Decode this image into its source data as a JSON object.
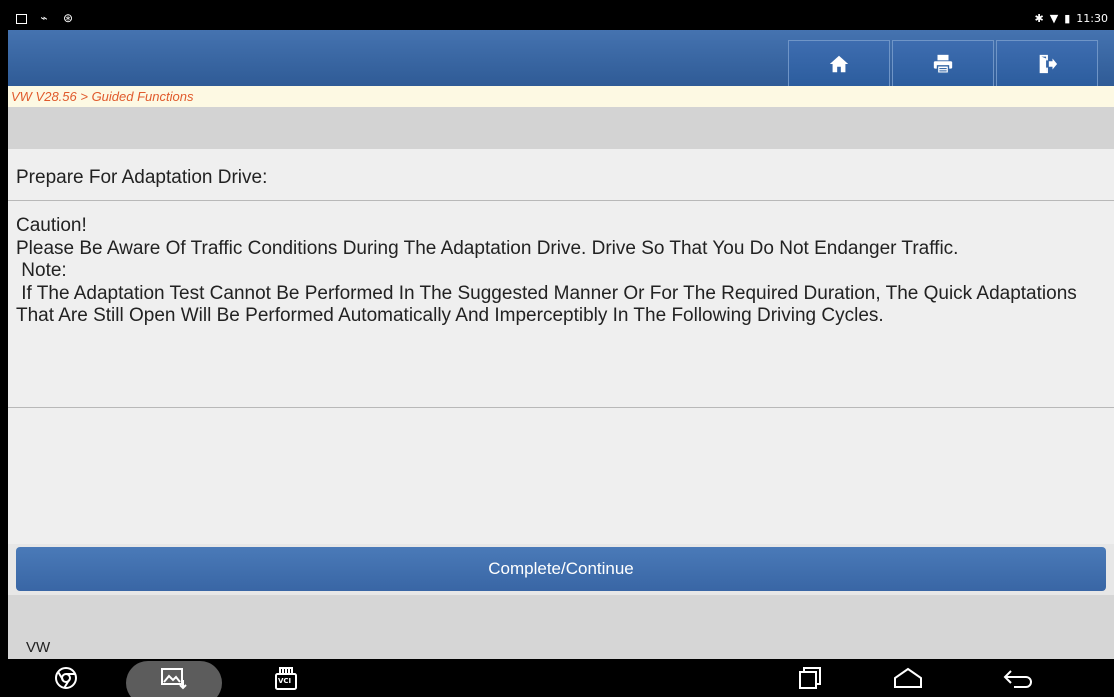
{
  "status": {
    "time": "11:30"
  },
  "breadcrumb": "VW V28.56 > Guided Functions",
  "header": {
    "home_icon": "home-icon",
    "print_icon": "printer-icon",
    "exit_icon": "exit-icon"
  },
  "content": {
    "title": "Prepare For Adaptation Drive:",
    "message": "Caution!\nPlease Be Aware Of Traffic Conditions During The Adaptation Drive. Drive So That You Do Not Endanger Traffic.\n Note:\n If The Adaptation Test Cannot Be Performed In The Suggested Manner Or For The Required Duration, The Quick Adaptations That Are Still Open Will Be Performed Automatically And Imperceptibly In The Following Driving Cycles."
  },
  "actions": {
    "continue_label": "Complete/Continue"
  },
  "footer": {
    "brand": "VW"
  },
  "navbar": {
    "vci_label": "VCI"
  },
  "colors": {
    "header_blue": "#3466a6",
    "breadcrumb_text": "#e05a2c",
    "breadcrumb_bg": "#fdf9e3",
    "button_blue": "#4272b0"
  }
}
